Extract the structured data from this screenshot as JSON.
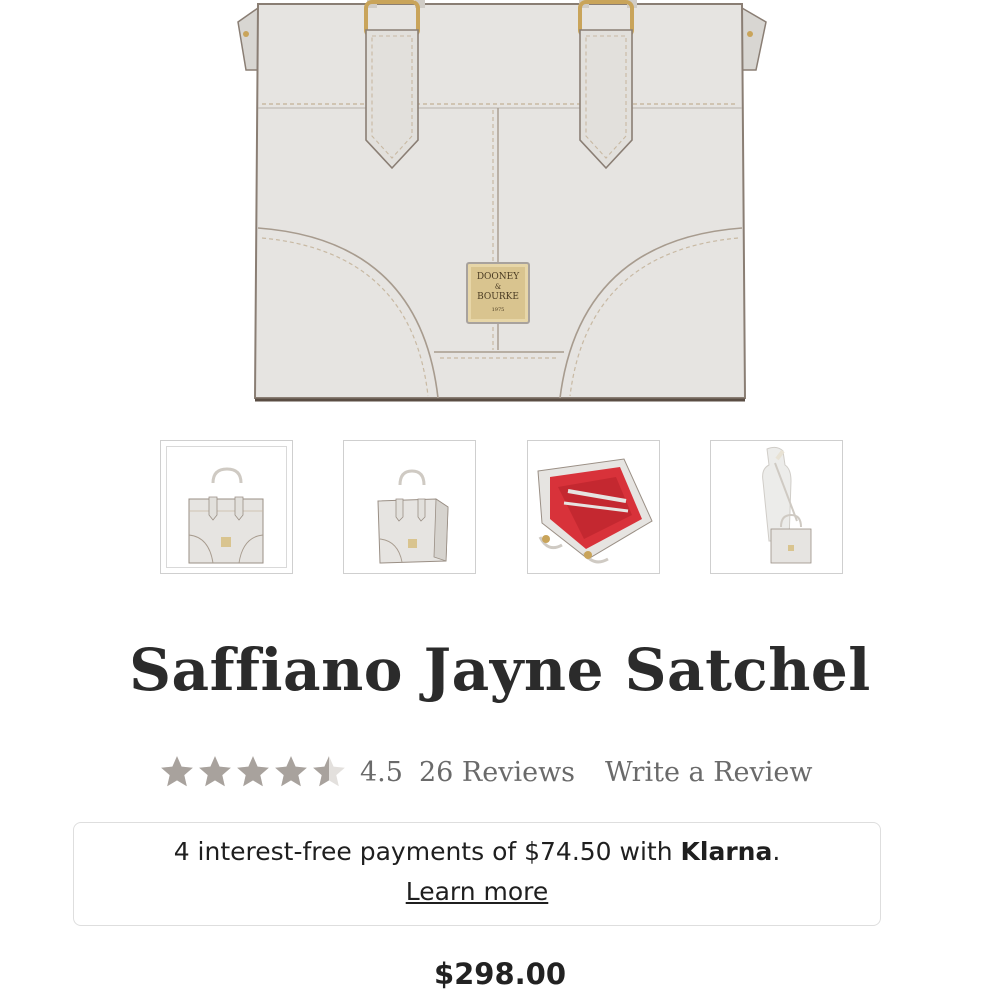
{
  "product": {
    "brand_badge_lines": [
      "DOONEY",
      "&",
      "BOURKE",
      "1975"
    ],
    "title": "Saffiano Jayne Satchel",
    "price": "$298.00"
  },
  "gallery": {
    "thumbnails": [
      {
        "view": "front",
        "selected": true
      },
      {
        "view": "angled"
      },
      {
        "view": "interior"
      },
      {
        "view": "on-form"
      }
    ]
  },
  "rating": {
    "value": "4.5",
    "stars_filled": 4.5,
    "stars_total": 5,
    "reviews_label": "26 Reviews",
    "write_review_label": "Write a Review"
  },
  "klarna": {
    "text_before": "4 interest-free payments of $74.50 with ",
    "brand": "Klarna",
    "text_after": ".",
    "learn_more_label": "Learn more"
  },
  "colors": {
    "bag": "#e6e4e1",
    "bag_edge": "#8a7e74",
    "stitching": "#c8b9a3",
    "hardware_gold": "#c9a45a",
    "star_gray": "#a8a29d",
    "interior_red": "#d8323a"
  }
}
